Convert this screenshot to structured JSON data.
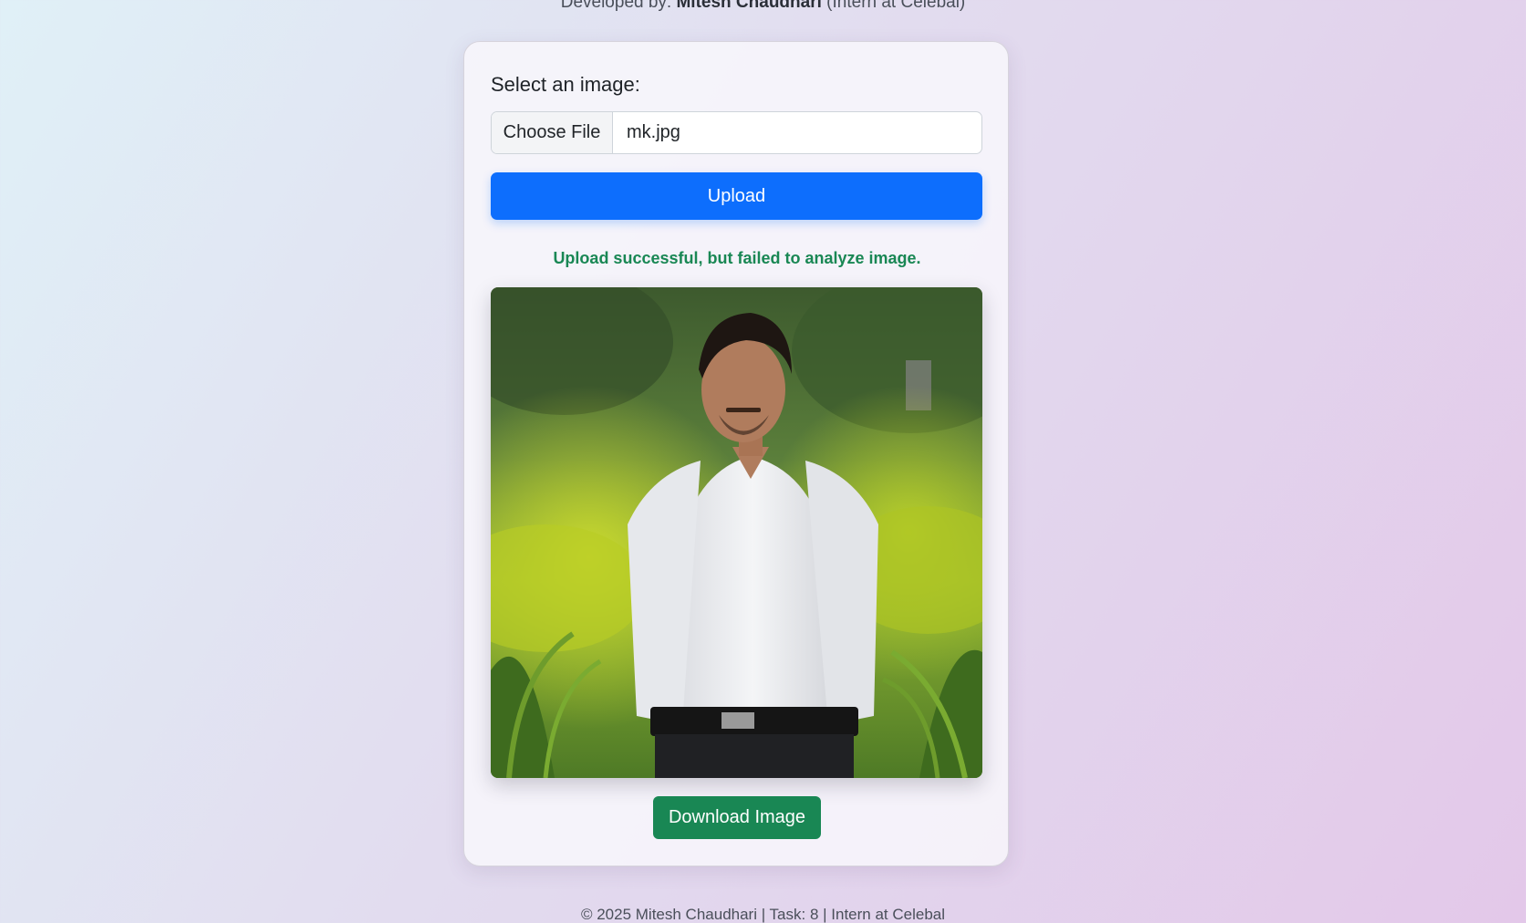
{
  "header": {
    "developed_by_prefix": "Developed by:",
    "developer_name": "Mitesh Chaudhari",
    "developer_suffix": "(Intern at Celebal)"
  },
  "form": {
    "label": "Select an image:",
    "choose_file_label": "Choose File",
    "file_name": "mk.jpg",
    "upload_label": "Upload"
  },
  "status": {
    "message": "Upload successful, but failed to analyze image.",
    "color": "#198754"
  },
  "preview": {
    "icon": "uploaded-photo"
  },
  "actions": {
    "download_label": "Download Image"
  },
  "footer": {
    "text": "© 2025 Mitesh Chaudhari | Task: 8 | Intern at Celebal"
  },
  "colors": {
    "primary": "#0d6efd",
    "success": "#198754"
  }
}
